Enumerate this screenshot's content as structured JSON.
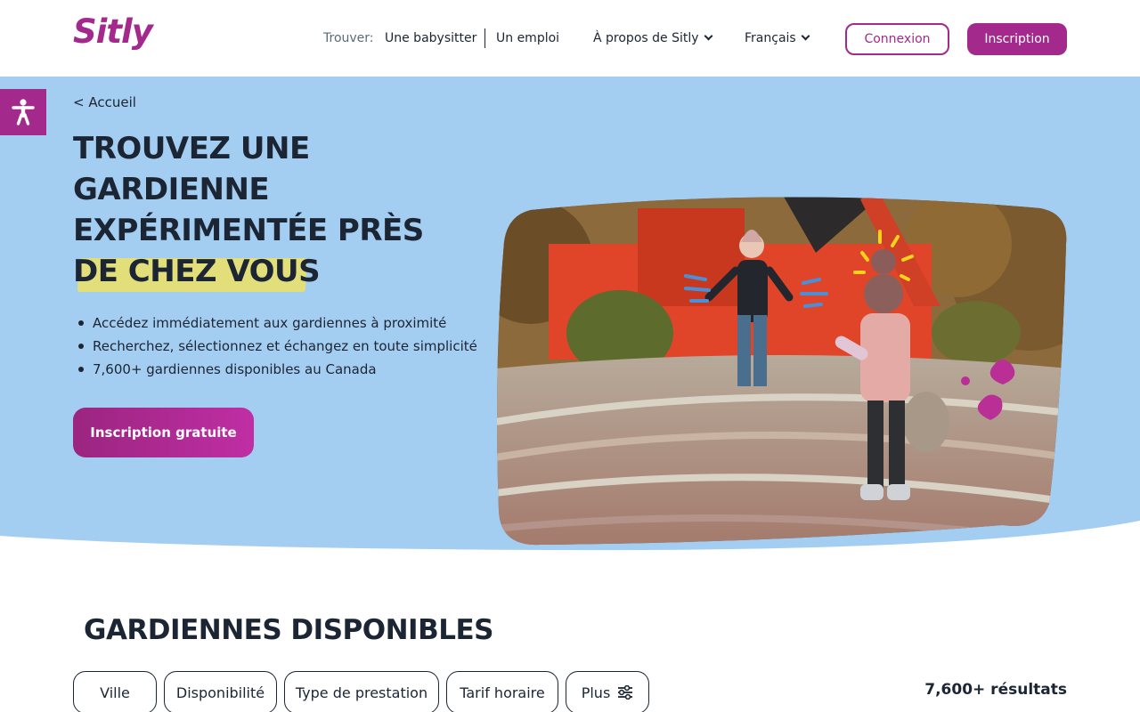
{
  "brand": {
    "logo_text": "Sitly",
    "color": "#a3298c"
  },
  "header": {
    "find_label": "Trouver:",
    "babysitter_link": "Une babysitter",
    "job_link": "Un emploi",
    "about_menu": "À propos de Sitly",
    "language_menu": "Français",
    "login_button": "Connexion",
    "signup_button": "Inscription"
  },
  "hero": {
    "breadcrumb": "< Accueil",
    "title_lines": [
      "TROUVEZ UNE",
      "GARDIENNE",
      "EXPÉRIMENTÉE PRÈS",
      "DE CHEZ VOUS"
    ],
    "bullets": [
      "Accédez immédiatement aux gardiennes à proximité",
      "Recherchez, sélectionnez et échangez en toute simplicité",
      "7,600+ gardiennes disponibles au Canada"
    ],
    "cta_button": "Inscription gratuite",
    "background_color": "#a4cdf2",
    "highlight_color": "#e2df7a"
  },
  "listing": {
    "title": "GARDIENNES DISPONIBLES",
    "filters": [
      "Ville",
      "Disponibilité",
      "Type de prestation",
      "Tarif horaire",
      "Plus"
    ],
    "results_count": "7,600+ résultats"
  },
  "icons": {
    "accessibility": "accessibility-icon",
    "filters": "sliders-icon"
  }
}
